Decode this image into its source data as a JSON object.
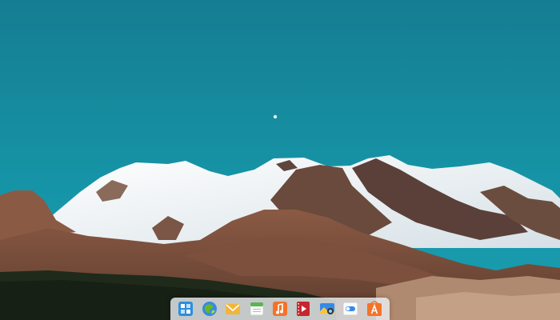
{
  "desktop": {
    "wallpaper": {
      "sky_color": "#1693a6",
      "snow_color": "#f2f4f5",
      "rock_color": "#7a5140",
      "forest_color": "#1f2a1a"
    }
  },
  "dock": {
    "background_color": "#ebeef0",
    "items": [
      {
        "icon": "multitasking-view-icon",
        "color": "#2a8fe0"
      },
      {
        "icon": "web-browser-icon",
        "color": "#3aa655"
      },
      {
        "icon": "mail-icon",
        "color": "#f0b63a"
      },
      {
        "icon": "calendar-icon",
        "color": "#5ab553"
      },
      {
        "icon": "music-icon",
        "color": "#f37329"
      },
      {
        "icon": "videos-icon",
        "color": "#c6262e"
      },
      {
        "icon": "photos-icon",
        "color": "#3689e6"
      },
      {
        "icon": "system-settings-icon",
        "color": "#3689e6"
      },
      {
        "icon": "appcenter-icon",
        "color": "#f37329"
      }
    ]
  }
}
